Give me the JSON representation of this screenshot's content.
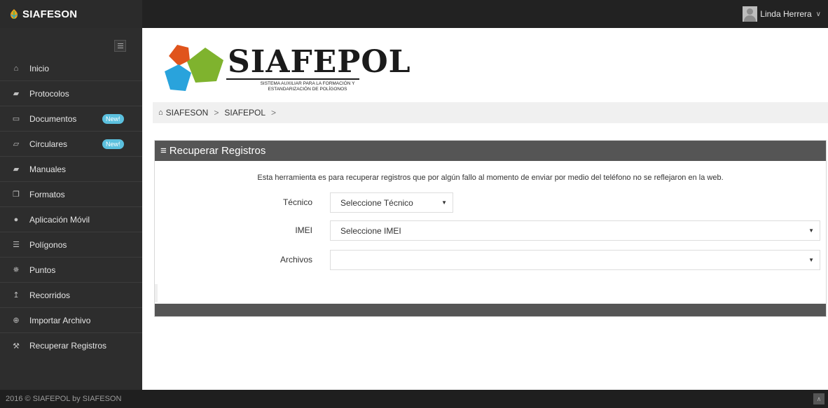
{
  "app": {
    "brand": "SIAFESON",
    "user_name": "Linda Herrera"
  },
  "sidebar": {
    "items": [
      {
        "label": "Inicio",
        "icon": "home-icon"
      },
      {
        "label": "Protocolos",
        "icon": "book-icon"
      },
      {
        "label": "Documentos",
        "icon": "folder-icon",
        "badge": "New!"
      },
      {
        "label": "Circulares",
        "icon": "folder-open-icon",
        "badge": "New!"
      },
      {
        "label": "Manuales",
        "icon": "book-icon"
      },
      {
        "label": "Formatos",
        "icon": "file-icon"
      },
      {
        "label": "Aplicación Móvil",
        "icon": "android-icon"
      },
      {
        "label": "Polígonos",
        "icon": "list-icon"
      },
      {
        "label": "Puntos",
        "icon": "spinner-icon"
      },
      {
        "label": "Recorridos",
        "icon": "level-up-icon"
      },
      {
        "label": "Importar Archivo",
        "icon": "plus-circle-icon"
      },
      {
        "label": "Recuperar Registros",
        "icon": "wrench-icon"
      }
    ]
  },
  "logo": {
    "title": "SIAFEPOL",
    "subtitle": "SISTEMA AUXILIAR PARA LA FORMACIÓN Y ESTANDARIZACIÓN DE POLÍGONOS",
    "colors": [
      "#e0541c",
      "#7fb32e",
      "#29a3dc"
    ]
  },
  "breadcrumb": {
    "items": [
      "SIAFESON",
      "SIAFEPOL"
    ]
  },
  "panel": {
    "title": "Recuperar Registros",
    "description": "Esta herramienta es para recuperar registros que por algún fallo al momento de enviar por medio del teléfono no se reflejaron en la web.",
    "fields": {
      "tecnico": {
        "label": "Técnico",
        "value": "Seleccione Técnico"
      },
      "imei": {
        "label": "IMEI",
        "value": "Seleccione IMEI"
      },
      "archivos": {
        "label": "Archivos",
        "value": ""
      }
    }
  },
  "footer": {
    "text": "2016 © SIAFEPOL by SIAFESON"
  },
  "colors": {
    "topbar": "#222222",
    "sidebar": "#2d2d2d",
    "panel_header": "#555555",
    "badge": "#5bc0de"
  }
}
